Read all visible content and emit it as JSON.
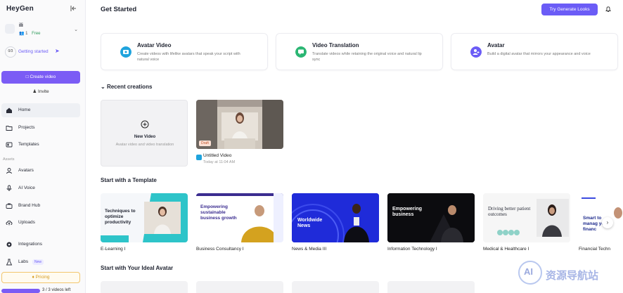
{
  "sidebar": {
    "logo": "HeyGen",
    "workspace": {
      "name": "ili",
      "members": "1",
      "plan": "Free"
    },
    "getting_started": {
      "progress": "0/3",
      "label": "Getting started"
    },
    "create_video": "Create video",
    "invite": "Invite",
    "nav": [
      {
        "label": "Home",
        "icon": "home-icon"
      },
      {
        "label": "Projects",
        "icon": "folder-icon"
      },
      {
        "label": "Templates",
        "icon": "template-icon"
      }
    ],
    "assets_label": "Assets",
    "assets": [
      {
        "label": "Avatars",
        "icon": "user-icon"
      },
      {
        "label": "AI Voice",
        "icon": "mic-icon"
      },
      {
        "label": "Brand Hub",
        "icon": "briefcase-icon"
      },
      {
        "label": "Uploads",
        "icon": "upload-icon"
      }
    ],
    "integrations": "Integrations",
    "labs": "Labs",
    "labs_badge": "New",
    "pricing": "Pricing",
    "usage_text": "3 / 3 videos left",
    "usage_fraction": 0.5
  },
  "header": {
    "title": "Get Started",
    "try_button": "Try Generate Looks"
  },
  "features": [
    {
      "title": "Avatar Video",
      "desc": "Create videos with lifelike avatars that speak your script with natural voice",
      "color": "#1fa3dd"
    },
    {
      "title": "Video Translation",
      "desc": "Translate videos while retaining the original voice and natural lip sync",
      "color": "#2bb673"
    },
    {
      "title": "Avatar",
      "desc": "Build a digital avatar that mirrors your appearance and voice",
      "color": "#6b5cf6"
    }
  ],
  "recent": {
    "title": "Recent creations",
    "new_video_title": "New Video",
    "new_video_sub": "Avatar video and video translation",
    "draft": "Draft",
    "video_name": "Untitled Video",
    "video_time": "Today at 11:04 AM"
  },
  "templates": {
    "title": "Start with a Template",
    "items": [
      {
        "label": "E-Learning I",
        "text": "Techniques to optimize productivity"
      },
      {
        "label": "Business Consultancy I",
        "text": "Empowering sustainable business growth"
      },
      {
        "label": "News & Media III",
        "text": "Worldwide News"
      },
      {
        "label": "Information Technology I",
        "text": "Empowering business"
      },
      {
        "label": "Medical & Healthcare I",
        "text": "Driving better patient outcomes"
      },
      {
        "label": "Financial Techn",
        "text": "Smart to manag your financ"
      }
    ]
  },
  "avatars_section": {
    "title": "Start with Your Ideal Avatar"
  },
  "watermark": {
    "text": "资源导航站",
    "logo": "AI"
  },
  "colors": {
    "accent": "#7b5cf5",
    "pricing": "#d59a1a"
  }
}
